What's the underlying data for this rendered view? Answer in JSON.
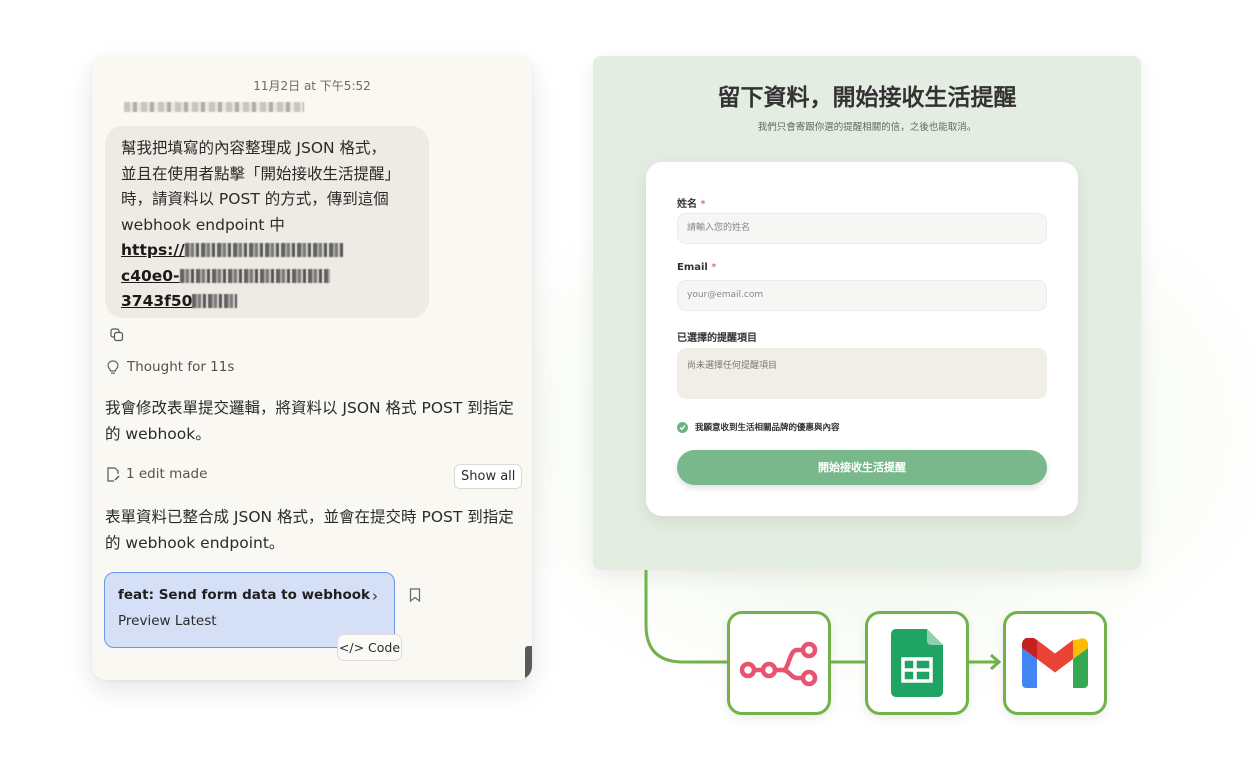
{
  "chat": {
    "timestamp": "11月2日 at 下午5:52",
    "user_message_lines": [
      "幫我把填寫的內容整理成 JSON 格式，",
      "並且在使用者點擊「開始接收生活提醒」",
      "時，請資料以 POST 的方式，傳到這個",
      "webhook endpoint 中"
    ],
    "url_visible_fragments": [
      "https://",
      "c40e0-",
      "3743f50"
    ],
    "thought_label": "Thought for 11s",
    "reply_1": "我會修改表單提交邏輯，將資料以 JSON 格式 POST 到指定的 webhook。",
    "edit_label": "1 edit made",
    "show_all_label": "Show all",
    "reply_2": "表單資料已整合成 JSON 格式，並會在提交時 POST 到指定的 webhook endpoint。",
    "commit_title": "feat: Send form data to webhook",
    "commit_subtitle": "Preview Latest",
    "code_button_label": "</> Code"
  },
  "form": {
    "title": "留下資料，開始接收生活提醒",
    "subtitle": "我們只會寄跟你選的提醒相關的信，之後也能取消。",
    "name_label": "姓名",
    "name_placeholder": "請輸入您的姓名",
    "email_label": "Email",
    "email_placeholder": "your@email.com",
    "required_mark": "*",
    "selected_label": "已選擇的提醒項目",
    "selected_empty": "尚未選擇任何提醒項目",
    "consent_label": "我願意收到生活相關品牌的優惠與內容",
    "submit_label": "開始接收生活提醒"
  },
  "flow": {
    "nodes": [
      "n8n-icon",
      "google-sheets-icon",
      "gmail-icon"
    ],
    "accent": "#73b14a"
  },
  "colors": {
    "commit_bg": "#d5e0f7",
    "commit_border": "#6e97e8",
    "submit_green": "#79b88a",
    "n8n_pink": "#e8546f"
  }
}
